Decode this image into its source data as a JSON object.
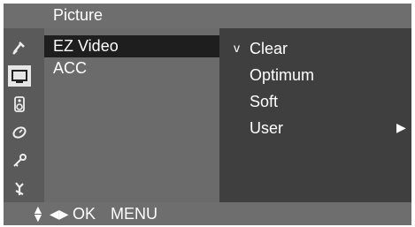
{
  "title": "Picture",
  "sidebar": {
    "icons": [
      {
        "name": "satellite-dish-icon",
        "selected": false
      },
      {
        "name": "picture-icon",
        "selected": true
      },
      {
        "name": "speaker-icon",
        "selected": false
      },
      {
        "name": "clock-icon",
        "selected": false
      },
      {
        "name": "lock-key-icon",
        "selected": false
      },
      {
        "name": "special-tool-icon",
        "selected": false
      }
    ]
  },
  "menu": {
    "items": [
      {
        "label": "EZ Video",
        "selected": true
      },
      {
        "label": "ACC",
        "selected": false
      }
    ]
  },
  "options": {
    "items": [
      {
        "label": "Clear",
        "check": "v",
        "arrow": ""
      },
      {
        "label": "Optimum",
        "check": "",
        "arrow": ""
      },
      {
        "label": "Soft",
        "check": "",
        "arrow": ""
      },
      {
        "label": "User",
        "check": "",
        "arrow": "▶"
      }
    ]
  },
  "footer": {
    "updown": "▲▼",
    "leftright": "◀▶",
    "ok": "OK",
    "menu": "MENU"
  }
}
